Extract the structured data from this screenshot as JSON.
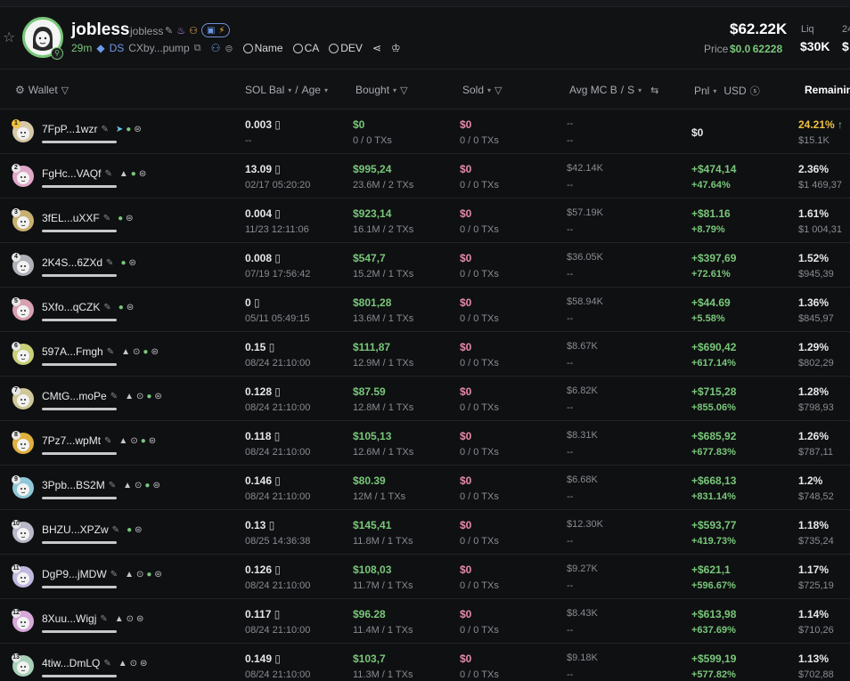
{
  "token": {
    "name": "jobless",
    "ticker": "jobless",
    "age": "29m",
    "ds_label": "DS",
    "ca_short": "CXby...pump",
    "links": [
      "Name",
      "CA",
      "DEV"
    ],
    "market_cap": "$62.22K",
    "price_label": "Price",
    "price_value": "$0.0 62228",
    "liq_label": "Liq",
    "liq_value": "$30K",
    "cut_label": "24",
    "cut_value": "$"
  },
  "columns": {
    "wallet": "Wallet",
    "sol_bal": "SOL Bal",
    "age": "Age",
    "bought": "Bought",
    "sold": "Sold",
    "avg_mc": "Avg MC B",
    "avg_s": "S",
    "pnl": "Pnl",
    "usd": "USD",
    "remaining": "Remaining"
  },
  "rows": [
    {
      "rank": "1",
      "wallet": "7FpP...1wzr",
      "tags": [
        "fish",
        "person",
        "bank"
      ],
      "sol": "0.003",
      "age": "--",
      "bought": "$0",
      "bought_sub": "0 / 0 TXs",
      "sold": "$0",
      "sold_sub": "0 / 0 TXs",
      "avg1": "--",
      "avg2": "--",
      "pnl1": "$0",
      "pnl2": "",
      "rem": "24.21%",
      "rem_usd": "$15.1K",
      "avatar": "#d7c9a8"
    },
    {
      "rank": "2",
      "wallet": "FgHc...VAQf",
      "tags": [
        "up",
        "person",
        "bank"
      ],
      "sol": "13.09",
      "age": "02/17 05:20:20",
      "bought": "$995,24",
      "bought_sub": "23.6M / 2 TXs",
      "sold": "$0",
      "sold_sub": "0 / 0 TXs",
      "avg1": "$42.14K",
      "avg2": "--",
      "pnl1": "+$474,14",
      "pnl2": "+47.64%",
      "rem": "2.36%",
      "rem_usd": "$1 469,37",
      "avatar": "#e0a8c8"
    },
    {
      "rank": "3",
      "wallet": "3fEL...uXXF",
      "tags": [
        "person",
        "bank"
      ],
      "sol": "0.004",
      "age": "11/23 12:11:06",
      "bought": "$923,14",
      "bought_sub": "16.1M / 2 TXs",
      "sold": "$0",
      "sold_sub": "0 / 0 TXs",
      "avg1": "$57.19K",
      "avg2": "--",
      "pnl1": "+$81.16",
      "pnl2": "+8.79%",
      "rem": "1.61%",
      "rem_usd": "$1 004,31",
      "avatar": "#c8b070"
    },
    {
      "rank": "4",
      "wallet": "2K4S...6ZXd",
      "tags": [
        "person",
        "bank"
      ],
      "sol": "0.008",
      "age": "07/19 17:56:42",
      "bought": "$547,7",
      "bought_sub": "15.2M / 1 TXs",
      "sold": "$0",
      "sold_sub": "0 / 0 TXs",
      "avg1": "$36.05K",
      "avg2": "--",
      "pnl1": "+$397,69",
      "pnl2": "+72.61%",
      "rem": "1.52%",
      "rem_usd": "$945,39",
      "avatar": "#b0b0b8"
    },
    {
      "rank": "5",
      "wallet": "5Xfo...qCZK",
      "tags": [
        "person",
        "bank"
      ],
      "sol": "0",
      "age": "05/11 05:49:15",
      "bought": "$801,28",
      "bought_sub": "13.6M / 1 TXs",
      "sold": "$0",
      "sold_sub": "0 / 0 TXs",
      "avg1": "$58.94K",
      "avg2": "--",
      "pnl1": "+$44.69",
      "pnl2": "+5.58%",
      "rem": "1.36%",
      "rem_usd": "$845,97",
      "avatar": "#d8a0b0"
    },
    {
      "rank": "6",
      "wallet": "597A...Fmgh",
      "tags": [
        "up",
        "target",
        "person",
        "bank"
      ],
      "sol": "0.15",
      "age": "08/24 21:10:00",
      "bought": "$111,87",
      "bought_sub": "12.9M / 1 TXs",
      "sold": "$0",
      "sold_sub": "0 / 0 TXs",
      "avg1": "$8.67K",
      "avg2": "--",
      "pnl1": "+$690,42",
      "pnl2": "+617.14%",
      "rem": "1.29%",
      "rem_usd": "$802,29",
      "avatar": "#c8d078"
    },
    {
      "rank": "7",
      "wallet": "CMtG...moPe",
      "tags": [
        "up",
        "target",
        "person",
        "bank"
      ],
      "sol": "0.128",
      "age": "08/24 21:10:00",
      "bought": "$87.59",
      "bought_sub": "12.8M / 1 TXs",
      "sold": "$0",
      "sold_sub": "0 / 0 TXs",
      "avg1": "$6.82K",
      "avg2": "--",
      "pnl1": "+$715,28",
      "pnl2": "+855.06%",
      "rem": "1.28%",
      "rem_usd": "$798,93",
      "avatar": "#d0c898"
    },
    {
      "rank": "8",
      "wallet": "7Pz7...wpMt",
      "tags": [
        "up",
        "target",
        "person",
        "bank"
      ],
      "sol": "0.118",
      "age": "08/24 21:10:00",
      "bought": "$105,13",
      "bought_sub": "12.6M / 1 TXs",
      "sold": "$0",
      "sold_sub": "0 / 0 TXs",
      "avg1": "$8.31K",
      "avg2": "--",
      "pnl1": "+$685,92",
      "pnl2": "+677.83%",
      "rem": "1.26%",
      "rem_usd": "$787,11",
      "avatar": "#e0b040"
    },
    {
      "rank": "9",
      "wallet": "3Ppb...BS2M",
      "tags": [
        "up",
        "target",
        "person",
        "bank"
      ],
      "sol": "0.146",
      "age": "08/24 21:10:00",
      "bought": "$80.39",
      "bought_sub": "12M / 1 TXs",
      "sold": "$0",
      "sold_sub": "0 / 0 TXs",
      "avg1": "$6.68K",
      "avg2": "--",
      "pnl1": "+$668,13",
      "pnl2": "+831.14%",
      "rem": "1.2%",
      "rem_usd": "$748,52",
      "avatar": "#90c8d8"
    },
    {
      "rank": "10",
      "wallet": "BHZU...XPZw",
      "tags": [
        "person",
        "bank"
      ],
      "sol": "0.13",
      "age": "08/25 14:36:38",
      "bought": "$145,41",
      "bought_sub": "11.8M / 1 TXs",
      "sold": "$0",
      "sold_sub": "0 / 0 TXs",
      "avg1": "$12.30K",
      "avg2": "--",
      "pnl1": "+$593,77",
      "pnl2": "+419.73%",
      "rem": "1.18%",
      "rem_usd": "$735,24",
      "avatar": "#b8b8c8"
    },
    {
      "rank": "11",
      "wallet": "DgP9...jMDW",
      "tags": [
        "up",
        "target",
        "person",
        "bank"
      ],
      "sol": "0.126",
      "age": "08/24 21:10:00",
      "bought": "$108,03",
      "bought_sub": "11.7M / 1 TXs",
      "sold": "$0",
      "sold_sub": "0 / 0 TXs",
      "avg1": "$9.27K",
      "avg2": "--",
      "pnl1": "+$621,1",
      "pnl2": "+596.67%",
      "rem": "1.17%",
      "rem_usd": "$725,19",
      "avatar": "#c0b8e0"
    },
    {
      "rank": "12",
      "wallet": "8Xuu...Wigj",
      "tags": [
        "up",
        "target",
        "bank"
      ],
      "sol": "0.117",
      "age": "08/24 21:10:00",
      "bought": "$96.28",
      "bought_sub": "11.4M / 1 TXs",
      "sold": "$0",
      "sold_sub": "0 / 0 TXs",
      "avg1": "$8.43K",
      "avg2": "--",
      "pnl1": "+$613,98",
      "pnl2": "+637.69%",
      "rem": "1.14%",
      "rem_usd": "$710,26",
      "avatar": "#d8a8d8"
    },
    {
      "rank": "13",
      "wallet": "4tiw...DmLQ",
      "tags": [
        "up",
        "target",
        "bank"
      ],
      "sol": "0.149",
      "age": "08/24 21:10:00",
      "bought": "$103,7",
      "bought_sub": "11.3M / 1 TXs",
      "sold": "$0",
      "sold_sub": "0 / 0 TXs",
      "avg1": "$9.18K",
      "avg2": "--",
      "pnl1": "+$599,19",
      "pnl2": "+577.82%",
      "rem": "1.13%",
      "rem_usd": "$702,88",
      "avatar": "#a8d0b8"
    }
  ]
}
